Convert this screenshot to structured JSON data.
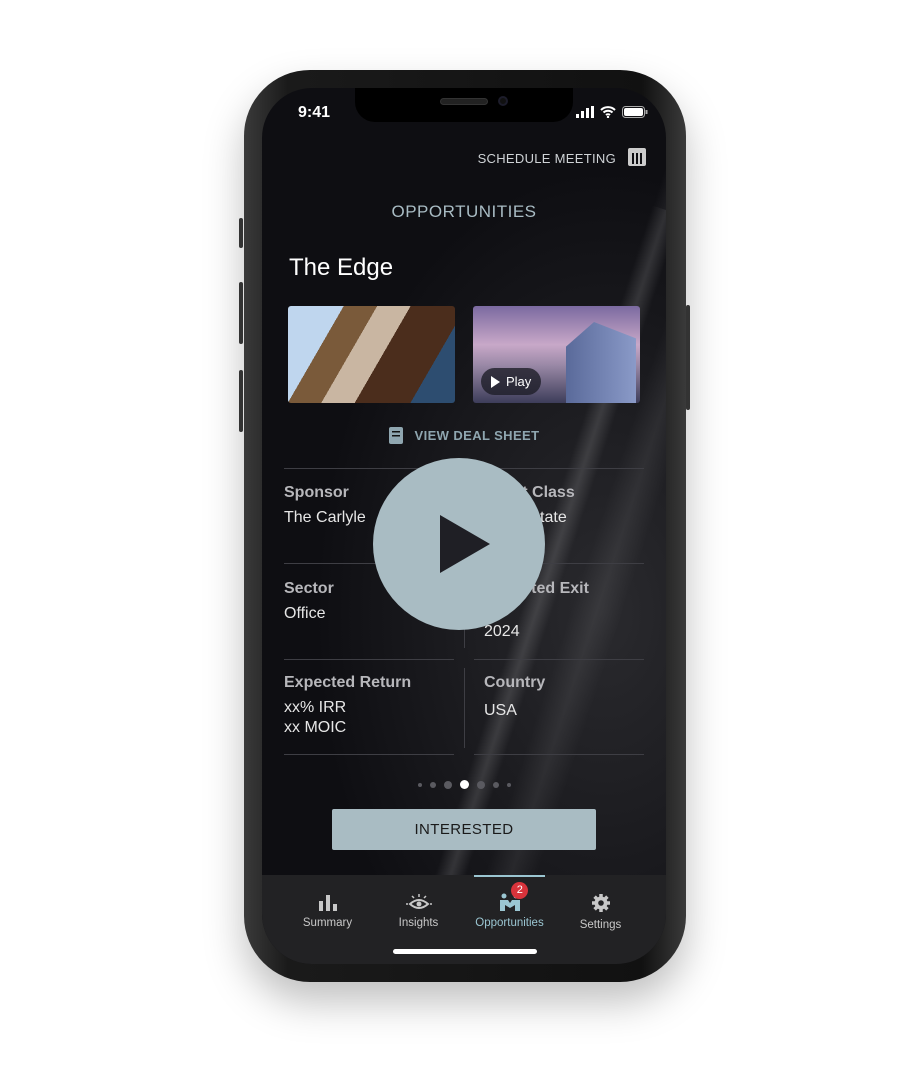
{
  "status_bar": {
    "time": "9:41"
  },
  "header": {
    "schedule_label": "SCHEDULE MEETING",
    "section_title": "OPPORTUNITIES"
  },
  "deal": {
    "title": "The Edge",
    "video_play_label": "Play",
    "view_deal_sheet": "VIEW DEAL SHEET",
    "fields": [
      {
        "label": "Sponsor",
        "value": [
          "The Carlyle"
        ]
      },
      {
        "label": "Asset Class",
        "value": [
          "Real Estate"
        ]
      },
      {
        "label": "Sector",
        "value": [
          "Office"
        ]
      },
      {
        "label": "Expected Exit",
        "value": [
          "2024"
        ]
      },
      {
        "label": "Expected Return",
        "value": [
          "xx% IRR",
          "xx MOIC"
        ]
      },
      {
        "label": "Country",
        "value": [
          "USA"
        ]
      }
    ],
    "pagination": {
      "total": 7,
      "current": 4
    }
  },
  "cta": {
    "interested_label": "INTERESTED"
  },
  "tabbar": {
    "items": [
      {
        "label": "Summary",
        "icon": "bar-chart-icon"
      },
      {
        "label": "Insights",
        "icon": "eye-icon"
      },
      {
        "label": "Opportunities",
        "icon": "handshake-people-icon",
        "badge": "2",
        "active": true
      },
      {
        "label": "Settings",
        "icon": "gear-icon"
      }
    ]
  },
  "colors": {
    "accent": "#a9bcc3",
    "active_tab": "#9bc6d2",
    "badge": "#d8333b"
  }
}
